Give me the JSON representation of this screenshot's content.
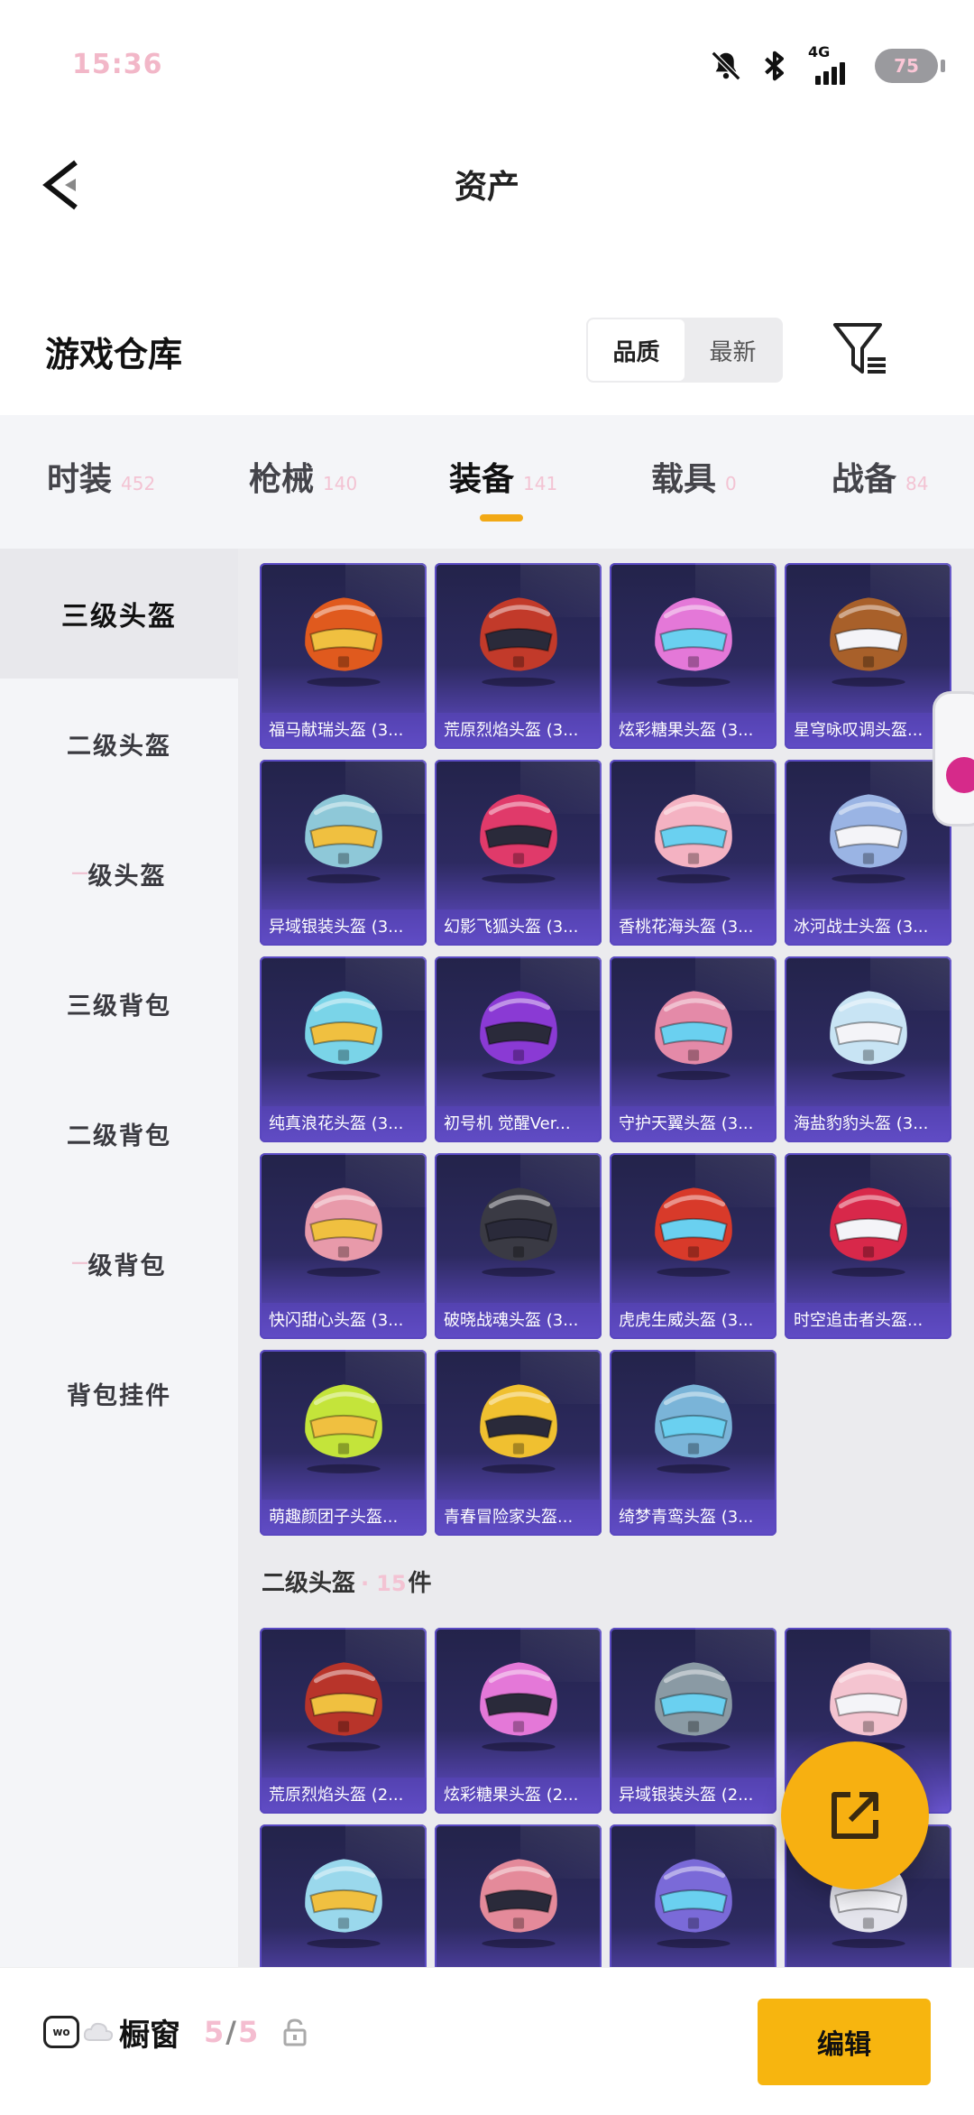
{
  "status_bar": {
    "time": "15:36",
    "network": "4G",
    "battery": "75",
    "icons": [
      "bell-muted-icon",
      "bluetooth-icon",
      "signal-icon",
      "battery-icon"
    ]
  },
  "header": {
    "title": "资产",
    "back_icon": "chevron-left-icon"
  },
  "storage": {
    "title": "游戏仓库",
    "sort_options": [
      {
        "label": "品质",
        "active": true
      },
      {
        "label": "最新",
        "active": false
      }
    ],
    "filter_icon": "filter-icon"
  },
  "category_tabs": [
    {
      "name": "时装",
      "count": "452",
      "active": false
    },
    {
      "name": "枪械",
      "count": "140",
      "active": false
    },
    {
      "name": "装备",
      "count": "141",
      "active": true
    },
    {
      "name": "载具",
      "count": "0",
      "active": false
    },
    {
      "name": "战备",
      "count": "84",
      "active": false
    }
  ],
  "sidebar": [
    {
      "label": "三级头盔",
      "active": true
    },
    {
      "label": "二级头盔",
      "active": false
    },
    {
      "prefix": "一",
      "label": "级头盔",
      "active": false
    },
    {
      "label": "三级背包",
      "active": false
    },
    {
      "label": "二级背包",
      "active": false
    },
    {
      "prefix": "一",
      "label": "级背包",
      "active": false
    },
    {
      "label": "背包挂件",
      "active": false
    }
  ],
  "level3_helmets": [
    {
      "name": "福马献瑞头盔 (3...",
      "color": "#e05a1e"
    },
    {
      "name": "荒原烈焰头盔 (3...",
      "color": "#c23a2a"
    },
    {
      "name": "炫彩糖果头盔 (3...",
      "color": "#e478d8"
    },
    {
      "name": "星穹咏叹调头盔...",
      "color": "#a8602a"
    },
    {
      "name": "异域银装头盔 (3...",
      "color": "#8ec8d8"
    },
    {
      "name": "幻影飞狐头盔 (3...",
      "color": "#e03a6a"
    },
    {
      "name": "香桃花海头盔 (3...",
      "color": "#f4b2c2"
    },
    {
      "name": "冰河战士头盔 (3...",
      "color": "#9ab4e4"
    },
    {
      "name": "纯真浪花头盔 (3...",
      "color": "#7ad4e8"
    },
    {
      "name": "初号机 觉醒Ver...",
      "color": "#8a3ad4"
    },
    {
      "name": "守护天翼头盔 (3...",
      "color": "#e48aa8"
    },
    {
      "name": "海盐豹豹头盔 (3...",
      "color": "#c8e4f4"
    },
    {
      "name": "快闪甜心头盔 (3...",
      "color": "#e89aaa"
    },
    {
      "name": "破晓战魂头盔 (3...",
      "color": "#3a3a44"
    },
    {
      "name": "虎虎生威头盔 (3...",
      "color": "#d83a2a"
    },
    {
      "name": "时空追击者头盔...",
      "color": "#d8284a"
    },
    {
      "name": "萌趣颜团子头盔...",
      "color": "#c4e43a"
    },
    {
      "name": "青春冒险家头盔...",
      "color": "#f0c030"
    },
    {
      "name": "绮梦青鸾头盔 (3...",
      "color": "#7ab4d8"
    }
  ],
  "section2": {
    "title": "二级头盔",
    "sep": "·",
    "count": "15",
    "unit": "件"
  },
  "level2_helmets": [
    {
      "name": "荒原烈焰头盔 (2...",
      "color": "#b8342a"
    },
    {
      "name": "炫彩糖果头盔 (2...",
      "color": "#e478d8"
    },
    {
      "name": "异域银装头盔 (2...",
      "color": "#8a9aa4"
    },
    {
      "name": "",
      "color": "#f4c4d0"
    },
    {
      "name": "",
      "color": "#9ad8ec"
    },
    {
      "name": "",
      "color": "#e48a9a"
    },
    {
      "name": "",
      "color": "#7a6ad8"
    },
    {
      "name": "",
      "color": "#e4e4ec"
    }
  ],
  "fab": {
    "icon": "share-external-icon"
  },
  "bottom_bar": {
    "title": "橱窗",
    "slots_used": "5",
    "slots_sep": "/",
    "slots_total": "5",
    "lock_icon": "lock-icon",
    "edit_label": "编辑"
  }
}
